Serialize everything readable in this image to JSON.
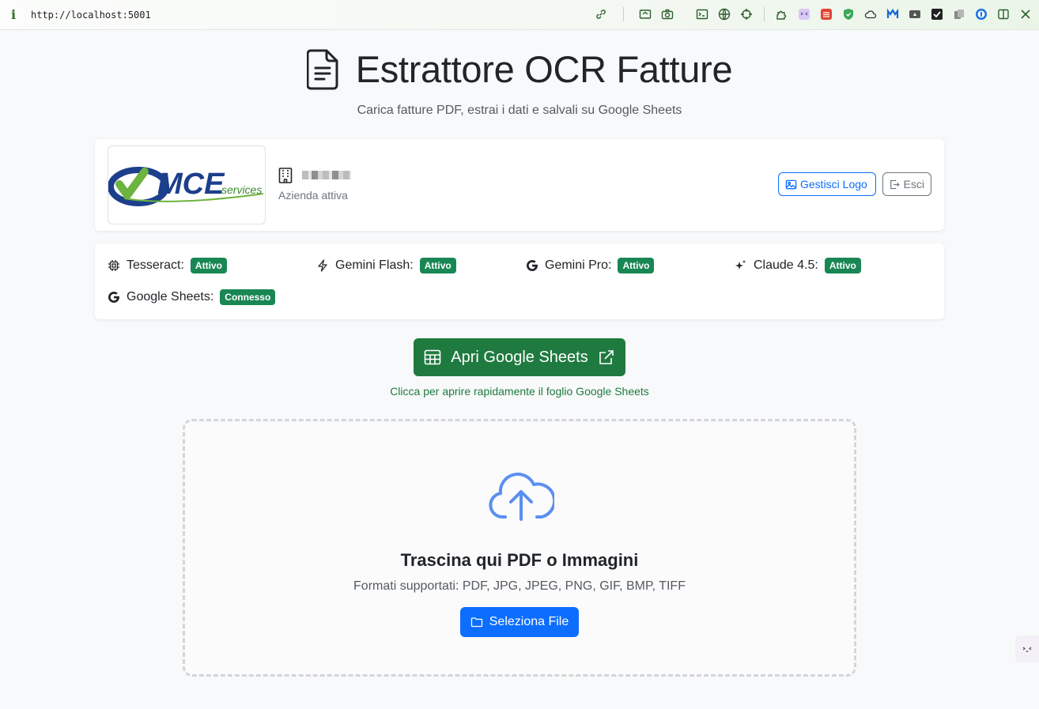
{
  "browser": {
    "info_icon": "i",
    "url": "http://localhost:5001"
  },
  "header": {
    "title": "Estrattore OCR Fatture",
    "subtitle": "Carica fatture PDF, estrai i dati e salvali su Google Sheets"
  },
  "company": {
    "logo_text_main": "MCE",
    "logo_text_sub": "services",
    "status": "Azienda attiva",
    "manage_logo_label": "Gestisci Logo",
    "logout_label": "Esci"
  },
  "services": [
    {
      "name": "Tesseract:",
      "status": "Attivo",
      "icon": "cpu-icon"
    },
    {
      "name": "Gemini Flash:",
      "status": "Attivo",
      "icon": "lightning-icon"
    },
    {
      "name": "Gemini Pro:",
      "status": "Attivo",
      "icon": "google-icon"
    },
    {
      "name": "Claude 4.5:",
      "status": "Attivo",
      "icon": "sparkles-icon"
    },
    {
      "name": "Google Sheets:",
      "status": "Connesso",
      "icon": "google-icon"
    }
  ],
  "sheets": {
    "button_label": "Apri Google Sheets",
    "hint": "Clicca per aprire rapidamente il foglio Google Sheets"
  },
  "upload": {
    "title": "Trascina qui PDF o Immagini",
    "formats": "Formati supportati: PDF, JPG, JPEG, PNG, GIF, BMP, TIFF",
    "button_label": "Seleziona File"
  },
  "colors": {
    "primary": "#0d6efd",
    "success": "#198754",
    "sheets_green": "#1f7a3f",
    "upload_icon": "#5b8ff0"
  }
}
